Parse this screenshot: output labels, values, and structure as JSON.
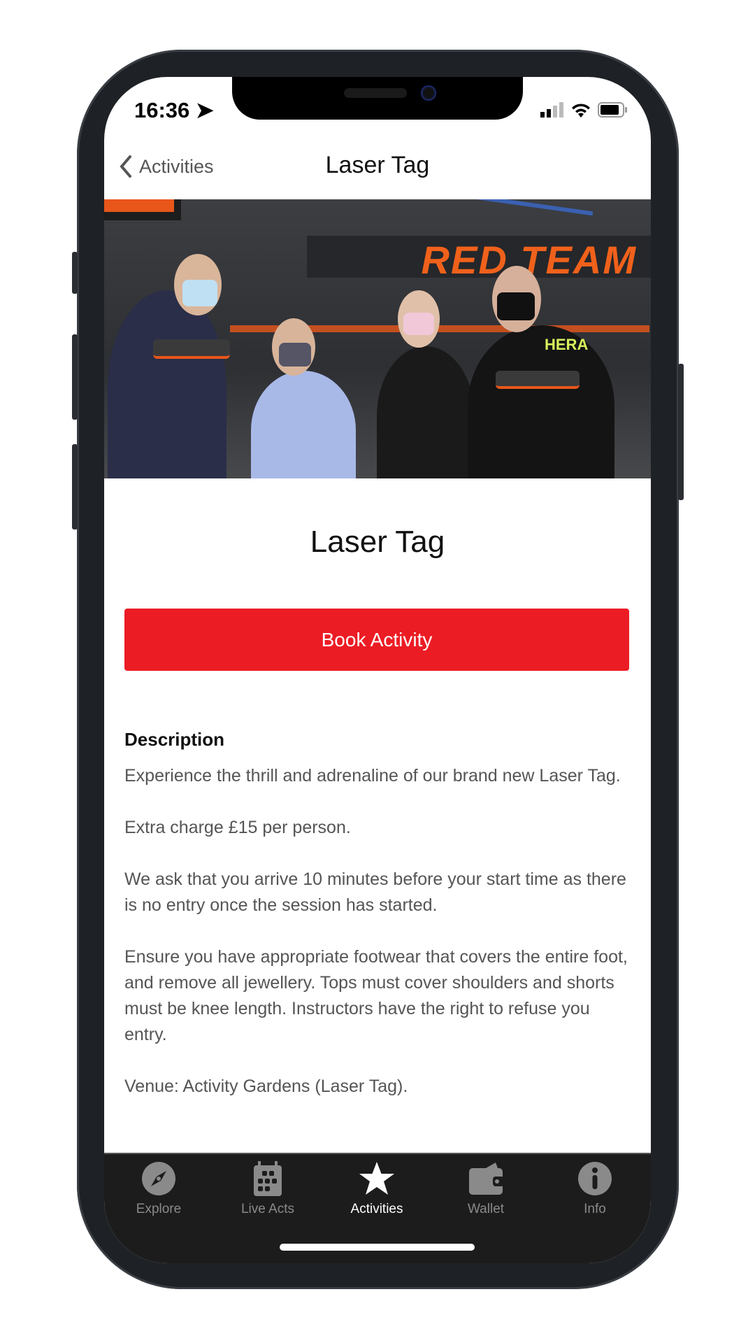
{
  "status_bar": {
    "time": "16:36"
  },
  "nav": {
    "back_label": "Activities",
    "title": "Laser Tag"
  },
  "photo": {
    "banner_text": "RED TEAM",
    "shirt_text": "HERA"
  },
  "activity": {
    "title": "Laser Tag",
    "book_label": "Book Activity",
    "accent_color": "#EC1C24"
  },
  "description": {
    "heading": "Description",
    "paragraphs": [
      "Experience the thrill and adrenaline of our brand new Laser Tag.",
      "Extra charge £15 per person.",
      "We ask that you arrive 10 minutes before your start time as there is no entry once the session has started.",
      "Ensure you have appropriate footwear that covers the entire foot, and remove all jewellery. Tops must cover shoulders and shorts must be knee length. Instructors have the right to refuse you entry.",
      "Venue: Activity Gardens (Laser Tag)."
    ]
  },
  "tabs": [
    {
      "label": "Explore",
      "icon": "compass-icon",
      "active": false
    },
    {
      "label": "Live Acts",
      "icon": "calendar-icon",
      "active": false
    },
    {
      "label": "Activities",
      "icon": "star-icon",
      "active": true
    },
    {
      "label": "Wallet",
      "icon": "wallet-icon",
      "active": false
    },
    {
      "label": "Info",
      "icon": "info-icon",
      "active": false
    }
  ]
}
